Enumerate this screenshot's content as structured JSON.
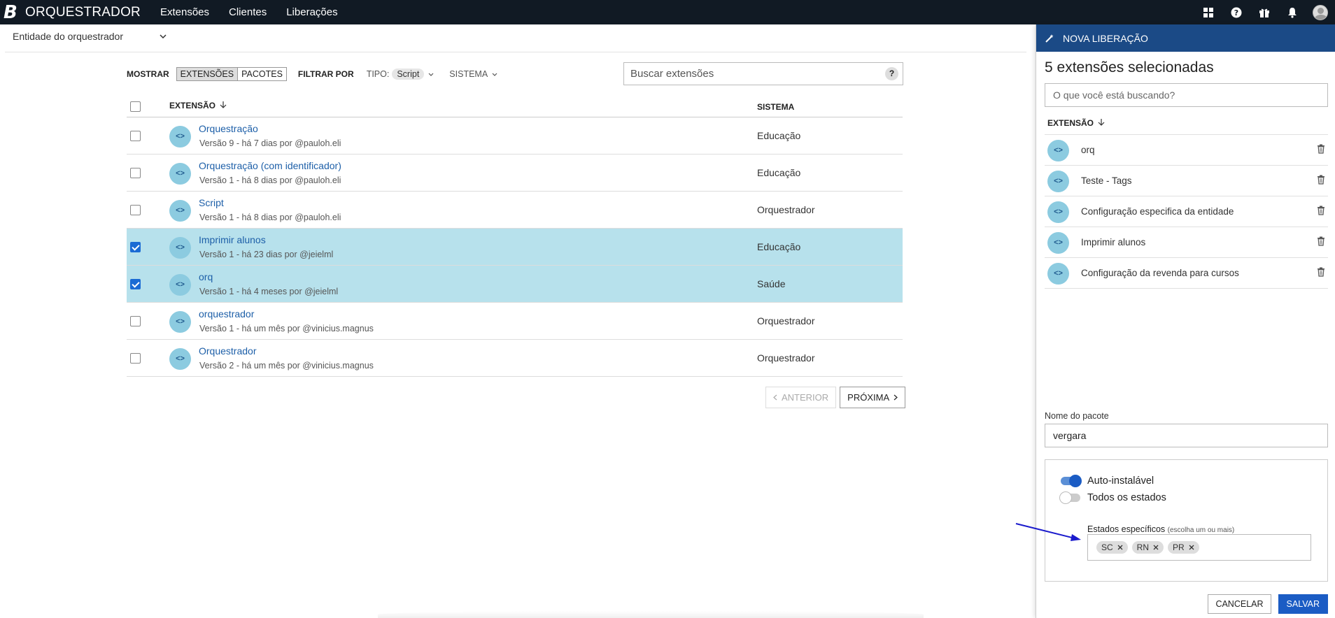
{
  "nav": {
    "logo": "B",
    "brand": "ORQUESTRADOR",
    "links": [
      "Extensões",
      "Clientes",
      "Liberações"
    ]
  },
  "entity": {
    "label": "Entidade do orquestrador"
  },
  "filters": {
    "show_label": "MOSTRAR",
    "tab_extensions": "EXTENSÕES",
    "tab_packages": "PACOTES",
    "filter_label": "FILTRAR POR",
    "tipo_label": "TIPO:",
    "tipo_value": "Script",
    "sistema_label": "SISTEMA",
    "search_placeholder": "Buscar extensões",
    "help": "?"
  },
  "table": {
    "col_extension": "EXTENSÃO",
    "col_system": "SISTEMA",
    "rows": [
      {
        "name": "Orquestração",
        "meta": "Versão 9 - há 7 dias por @pauloh.eli",
        "system": "Educação",
        "checked": false
      },
      {
        "name": "Orquestração (com identificador)",
        "meta": "Versão 1 - há 8 dias por @pauloh.eli",
        "system": "Educação",
        "checked": false
      },
      {
        "name": "Script",
        "meta": "Versão 1 - há 8 dias por @pauloh.eli",
        "system": "Orquestrador",
        "checked": false
      },
      {
        "name": "Imprimir alunos",
        "meta": "Versão 1 - há 23 dias por @jeielml",
        "system": "Educação",
        "checked": true
      },
      {
        "name": "orq",
        "meta": "Versão 1 - há 4 meses por @jeielml",
        "system": "Saúde",
        "checked": true
      },
      {
        "name": "orquestrador",
        "meta": "Versão 1 - há um mês por @vinicius.magnus",
        "system": "Orquestrador",
        "checked": false
      },
      {
        "name": "Orquestrador",
        "meta": "Versão 2 - há um mês por @vinicius.magnus",
        "system": "Orquestrador",
        "checked": false
      }
    ]
  },
  "pager": {
    "prev": "ANTERIOR",
    "next": "PRÓXIMA"
  },
  "panel": {
    "header": "NOVA LIBERAÇÃO",
    "title": "5 extensões selecionadas",
    "search_placeholder": "O que você está buscando?",
    "col_extension": "EXTENSÃO",
    "items": [
      "orq",
      "Teste - Tags",
      "Configuração especifica da entidade",
      "Imprimir alunos",
      "Configuração da revenda para cursos"
    ],
    "package_label": "Nome do pacote",
    "package_value": "vergara",
    "auto_install": "Auto-instalável",
    "all_states": "Todos os estados",
    "states_label": "Estados específicos",
    "states_hint": "(escolha um ou mais)",
    "states": [
      "SC",
      "RN",
      "PR"
    ],
    "cancel": "CANCELAR",
    "save": "SALVAR"
  },
  "colors": {
    "nav_bg": "#111a24",
    "panel_header": "#1b4a86",
    "selected_row": "#b7e1ec",
    "accent": "#1b5cc4",
    "link": "#1d5fa8",
    "annotation_arrow": "#1a1acc"
  },
  "icons": [
    "apps-grid-icon",
    "help-icon",
    "gift-icon",
    "bell-icon",
    "user-avatar",
    "code-icon",
    "trash-icon",
    "wand-icon",
    "sort-down-icon",
    "chevron-down-icon"
  ]
}
